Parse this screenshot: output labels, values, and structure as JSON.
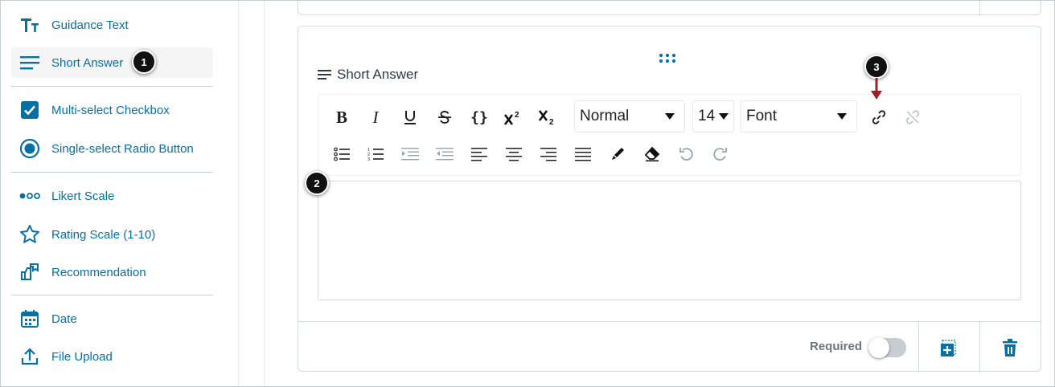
{
  "sidebar": {
    "items": [
      {
        "label": "Guidance Text",
        "icon": "text-size-icon"
      },
      {
        "label": "Short Answer",
        "icon": "short-answer-icon"
      },
      {
        "label": "Multi-select Checkbox",
        "icon": "checkbox-icon"
      },
      {
        "label": "Single-select Radio Button",
        "icon": "radio-button-icon"
      },
      {
        "label": "Likert Scale",
        "icon": "likert-dots-icon"
      },
      {
        "label": "Rating Scale (1-10)",
        "icon": "star-icon"
      },
      {
        "label": "Recommendation",
        "icon": "recommendation-icon"
      },
      {
        "label": "Date",
        "icon": "calendar-icon"
      },
      {
        "label": "File Upload",
        "icon": "upload-icon"
      }
    ],
    "active_index": 1
  },
  "callouts": {
    "one": "1",
    "two": "2",
    "three": "3"
  },
  "question": {
    "type_label": "Short Answer"
  },
  "toolbar": {
    "paragraph_format": "Normal",
    "font_size": "14",
    "font_family": "Font"
  },
  "footer": {
    "required_label": "Required",
    "required_on": false
  },
  "colors": {
    "accent": "#0770a3",
    "callout_arrow": "#a31e1e",
    "badge": "#111111"
  }
}
